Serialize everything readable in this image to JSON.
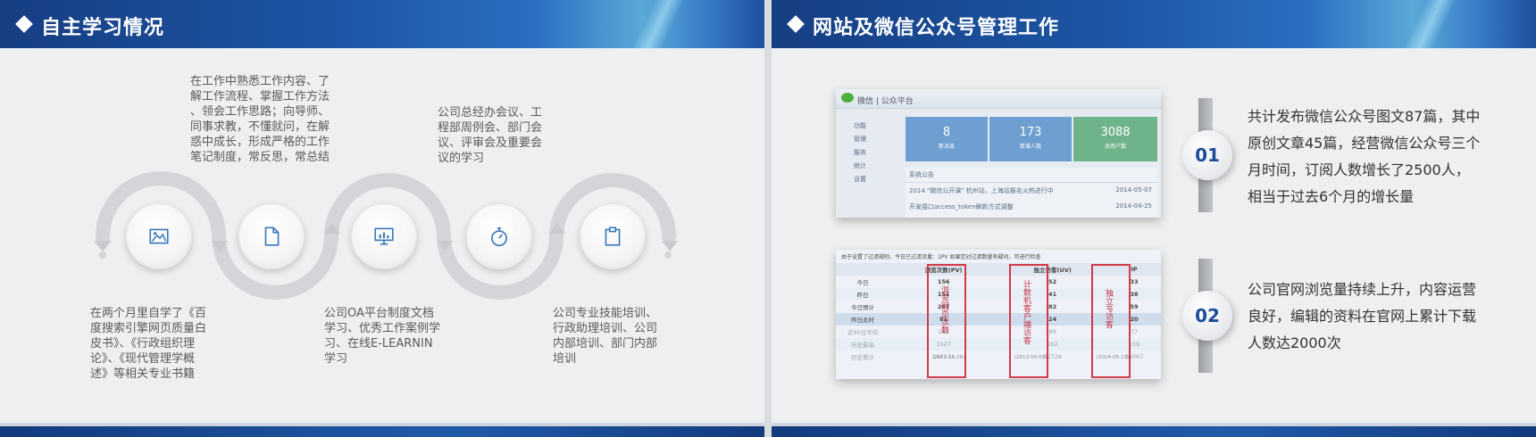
{
  "left": {
    "title": "自主学习情况",
    "top_texts": [
      [
        "在工作中熟悉工作内容、了",
        "解工作流程、掌握工作方法",
        "、领会工作思路；向导师、",
        "同事求教，不懂就问，在解",
        "惑中成长，形成严格的工作",
        "笔记制度，常反思，常总结"
      ],
      [
        "公司总经办会议、工",
        "程部周例会、部门会",
        "议、评审会及重要会",
        "议的学习"
      ]
    ],
    "bottom_texts": [
      [
        "在两个月里自学了《百",
        "度搜索引擎网页质量白",
        "皮书》、《行政组织理",
        "论》、《现代管理学概",
        "述》等相关专业书籍"
      ],
      [
        "公司OA平台制度文档",
        "学习、优秀工作案例学",
        "习、在线E-LEARNIN",
        "学习"
      ],
      [
        "公司专业技能培训、",
        "行政助理培训、公司",
        "内部培训、部门内部",
        "培训"
      ]
    ],
    "circles": [
      {
        "icon": "image-icon"
      },
      {
        "icon": "document-icon"
      },
      {
        "icon": "presentation-icon"
      },
      {
        "icon": "stopwatch-icon"
      },
      {
        "icon": "clipboard-icon"
      }
    ]
  },
  "right": {
    "title": "网站及微信公众号管理工作",
    "item1": {
      "number": "01",
      "lines": [
        "共计发布微信公众号图文87篇，其中",
        "原创文章45篇，经营微信公众号三个",
        "月时间，订阅人数增长了2500人，",
        "相当于过去6个月的增长量"
      ]
    },
    "item2": {
      "number": "02",
      "lines": [
        "公司官网浏览量持续上升，内容运营",
        "良好，编辑的资料在官网上累计下载",
        "人数达2000次"
      ]
    },
    "wechat": {
      "brand": "微信 | 公众平台",
      "menu": [
        "功能",
        "管理",
        "服务",
        "统计",
        "设置"
      ],
      "stats": [
        {
          "value": "8",
          "label": "新消息"
        },
        {
          "value": "173",
          "label": "新增人数"
        },
        {
          "value": "3088",
          "label": "总用户数"
        }
      ],
      "notice_title": "系统公告",
      "notices": [
        {
          "text": "2014 \"微信公开课\" 杭州站，上海站报名火热进行中",
          "date": "2014-05-07"
        },
        {
          "text": "开发接口access_token刷新方式调整",
          "date": "2014-04-25"
        }
      ]
    },
    "stats_table": {
      "note": "由于设置了过滤规则，今日已过滤流量：1PV  如果您对过滤数量有疑问，可进行检查",
      "headers": [
        "",
        "浏览次数(PV)",
        "独立访客(UV)",
        "IP"
      ],
      "rows": [
        [
          "今日",
          "156",
          "52",
          "33"
        ],
        [
          "昨日",
          "151",
          "41",
          "38"
        ],
        [
          "今日预计",
          "267",
          "82",
          "59"
        ],
        [
          "昨日此时",
          "81",
          "24",
          "20"
        ],
        [
          "近90日平均",
          "262",
          "89",
          "77"
        ],
        [
          "历史最高",
          "1027",
          "202",
          "159"
        ],
        [
          "历史累计",
          "142174",
          "30726",
          "24067"
        ]
      ],
      "annotations": [
        "浏览网页次数",
        "计数机客户端访客",
        "独立IP访客"
      ],
      "history_dates": [
        "(2013-11-26)",
        "(2013-09-09)",
        "(2014-05-19)"
      ]
    }
  }
}
